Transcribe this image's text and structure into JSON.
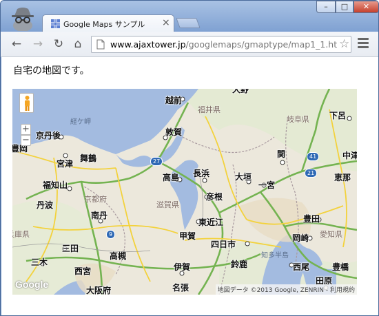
{
  "browser": {
    "tab": {
      "title": "Google Maps サンプル",
      "close_glyph": "×"
    },
    "window_controls": {
      "minimize_glyph": "–",
      "maximize_glyph": "□",
      "close_glyph": "✕"
    },
    "toolbar": {
      "back_glyph": "←",
      "forward_glyph": "→",
      "reload_glyph": "↻",
      "home_glyph": "⌂"
    },
    "address": {
      "host": "www.ajaxtower.jp",
      "path": "/googlemaps/gmaptype/map1_1.ht"
    },
    "star_glyph": "☆",
    "icons": {
      "profile": "incognito-icon",
      "favicon": "google-maps-favicon",
      "page": "page-icon",
      "bookmark": "star-icon",
      "menu": "menu-icon"
    }
  },
  "page": {
    "heading": "自宅の地図です。"
  },
  "map": {
    "controls": {
      "zoom_in": "+",
      "zoom_out": "−"
    },
    "logo": "Google",
    "attribution": {
      "text": "地図データ ©2013 Google, ZENRIN - ",
      "terms": "利用規約"
    },
    "places": [
      {
        "id": "ono",
        "label": "大野"
      },
      {
        "id": "echizen",
        "label": "越前"
      },
      {
        "id": "fukui-ken",
        "label": "福井県"
      },
      {
        "id": "gifu-ken",
        "label": "岐阜県"
      },
      {
        "id": "gero",
        "label": "下呂"
      },
      {
        "id": "kyogamisaki",
        "label": "経ケ岬"
      },
      {
        "id": "kyotango",
        "label": "京丹後"
      },
      {
        "id": "tsuruga",
        "label": "敦賀"
      },
      {
        "id": "toyooka",
        "label": "豊岡"
      },
      {
        "id": "miyazu",
        "label": "宮津"
      },
      {
        "id": "maizuru",
        "label": "舞鶴"
      },
      {
        "id": "seki",
        "label": "関"
      },
      {
        "id": "nakatsugawa",
        "label": "中津"
      },
      {
        "id": "takashima",
        "label": "高島"
      },
      {
        "id": "nagahama",
        "label": "長浜"
      },
      {
        "id": "ogaki",
        "label": "大垣"
      },
      {
        "id": "ena",
        "label": "恵那"
      },
      {
        "id": "fukuchiyama",
        "label": "福知山"
      },
      {
        "id": "kyoto-fu",
        "label": "京都府"
      },
      {
        "id": "ichinomiya",
        "label": "一宮"
      },
      {
        "id": "hikone",
        "label": "彦根"
      },
      {
        "id": "shiga-ken",
        "label": "滋賀県"
      },
      {
        "id": "tamba",
        "label": "丹波"
      },
      {
        "id": "nantan",
        "label": "南丹"
      },
      {
        "id": "higashiomi",
        "label": "東近江"
      },
      {
        "id": "toyota",
        "label": "豊田"
      },
      {
        "id": "hyogo-ken",
        "label": "兵庫県"
      },
      {
        "id": "koka",
        "label": "甲賀"
      },
      {
        "id": "okazaki",
        "label": "岡崎"
      },
      {
        "id": "aichi-ken",
        "label": "愛知県"
      },
      {
        "id": "sanda",
        "label": "三田"
      },
      {
        "id": "yokkaichi",
        "label": "四日市"
      },
      {
        "id": "chita-hanto",
        "label": "知多半島"
      },
      {
        "id": "miki",
        "label": "三木"
      },
      {
        "id": "takatsuki",
        "label": "高槻"
      },
      {
        "id": "suzuka",
        "label": "鈴鹿"
      },
      {
        "id": "nishinomiya",
        "label": "西宮"
      },
      {
        "id": "iga",
        "label": "伊賀"
      },
      {
        "id": "nishio",
        "label": "西尾"
      },
      {
        "id": "toyohashi",
        "label": "豊橋"
      },
      {
        "id": "osaka-fu",
        "label": "大阪府"
      },
      {
        "id": "nabari",
        "label": "名張"
      },
      {
        "id": "tahara",
        "label": "田原"
      }
    ],
    "routes": [
      "27",
      "9",
      "41",
      "21"
    ]
  }
}
